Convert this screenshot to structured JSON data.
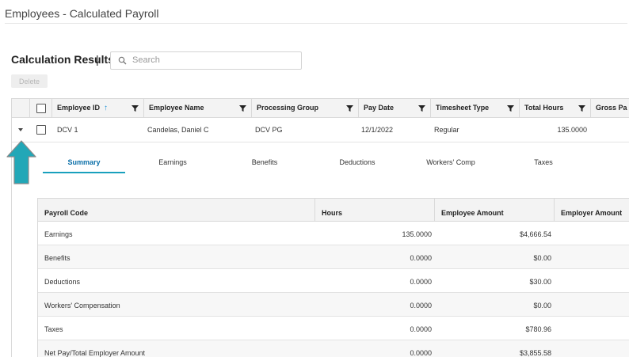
{
  "page": {
    "title": "Employees - Calculated Payroll"
  },
  "results": {
    "label": "Calculation Results",
    "separator": "|"
  },
  "search": {
    "placeholder": "Search",
    "value": ""
  },
  "toolbar": {
    "delete_label": "Delete"
  },
  "grid": {
    "columns": [
      {
        "label": "Employee ID",
        "sort": "ascending"
      },
      {
        "label": "Employee Name"
      },
      {
        "label": "Processing Group"
      },
      {
        "label": "Pay Date"
      },
      {
        "label": "Timesheet Type"
      },
      {
        "label": "Total Hours"
      },
      {
        "label": "Gross Pa"
      }
    ],
    "rows": [
      {
        "employee_id": "DCV 1",
        "employee_name": "Candelas, Daniel C",
        "processing_group": "DCV PG",
        "pay_date": "12/1/2022",
        "timesheet_type": "Regular",
        "total_hours": "135.0000",
        "expanded": true
      }
    ]
  },
  "detail_tabs": [
    {
      "label": "Summary",
      "active": true
    },
    {
      "label": "Earnings"
    },
    {
      "label": "Benefits"
    },
    {
      "label": "Deductions"
    },
    {
      "label": "Workers' Comp"
    },
    {
      "label": "Taxes"
    }
  ],
  "summary": {
    "columns": [
      "Payroll Code",
      "Hours",
      "Employee Amount",
      "Employer Amount"
    ],
    "rows": [
      {
        "code": "Earnings",
        "hours": "135.0000",
        "employee_amount": "$4,666.54",
        "employer_amount": ""
      },
      {
        "code": "Benefits",
        "hours": "0.0000",
        "employee_amount": "$0.00",
        "employer_amount": ""
      },
      {
        "code": "Deductions",
        "hours": "0.0000",
        "employee_amount": "$30.00",
        "employer_amount": ""
      },
      {
        "code": "Workers' Compensation",
        "hours": "0.0000",
        "employee_amount": "$0.00",
        "employer_amount": ""
      },
      {
        "code": "Taxes",
        "hours": "0.0000",
        "employee_amount": "$780.96",
        "employer_amount": ""
      },
      {
        "code": "Net Pay/Total Employer Amount",
        "hours": "0.0000",
        "employee_amount": "$3,855.58",
        "employer_amount": ""
      }
    ]
  },
  "colors": {
    "accent": "#19a0bd",
    "active_tab_text": "#0b6fa8",
    "sort_arrow": "#1a8fd6",
    "annotation_arrow": "#22a7b7"
  },
  "icons": {
    "search": "search-icon",
    "filter": "filter-icon",
    "sort": "sort-ascending-icon",
    "expander": "collapse-caret-icon"
  }
}
